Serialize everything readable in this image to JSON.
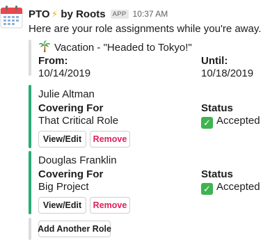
{
  "header": {
    "app_name": "PTO",
    "bolt": "⚡",
    "by": "by Roots",
    "badge": "APP",
    "time": "10:37 AM"
  },
  "intro": "Here are your role assignments while you're away.",
  "vacation": {
    "title": "Vacation - \"Headed to Tokyo!\"",
    "from_label": "From:",
    "from_value": "10/14/2019",
    "until_label": "Until:",
    "until_value": "10/18/2019"
  },
  "roles": [
    {
      "person": "Julie Altman",
      "covering_label": "Covering For",
      "covering_value": "That Critical Role",
      "status_label": "Status",
      "status_value": "Accepted",
      "view_edit": "View/Edit",
      "remove": "Remove"
    },
    {
      "person": "Douglas Franklin",
      "covering_label": "Covering For",
      "covering_value": "Big Project",
      "status_label": "Status",
      "status_value": "Accepted",
      "view_edit": "View/Edit",
      "remove": "Remove"
    }
  ],
  "add_role": "Add Another Role",
  "colors": {
    "accepted_bar": "#2bac76",
    "neutral_bar": "#dddddd",
    "danger": "#e01e5a",
    "check": "#3fb34f"
  },
  "icons": {
    "avatar": "calendar-icon",
    "vacation": "palm-tree-icon",
    "status": "check-mark-icon"
  }
}
